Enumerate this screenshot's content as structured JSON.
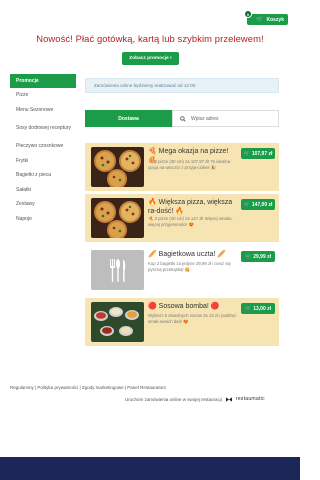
{
  "header": {
    "cart_label": "Koszyk",
    "cart_count": "0",
    "headline": "Nowość! Płać gotówką, kartą lub szybkim przelewem!",
    "promo_button": "Zobacz promocje !"
  },
  "sidebar": {
    "items": [
      {
        "label": "Promocje",
        "active": true
      },
      {
        "label": "Pizze"
      },
      {
        "label": "Menu Sezonowe"
      },
      {
        "label": "Sosy dodrowej receptury"
      },
      {
        "label": "Pieczywo czosnkowe"
      },
      {
        "label": "Frytki"
      },
      {
        "label": "Bagietki z pieca"
      },
      {
        "label": "Sałatki"
      },
      {
        "label": "Zestawy"
      },
      {
        "label": "Napoje"
      }
    ]
  },
  "main": {
    "notice": "Zamówienia online będziemy realizować od 12:00",
    "tab_delivery": "Dostawa",
    "address_placeholder": "Wpisz adres",
    "items": [
      {
        "title": "🍕 Mega okazja na pizze! 🍕",
        "desc": "🍕 3 pizze (30 cm) za 107,97 zł! To idealna opcja na wieczór z przyja-ciółmi! 🎉",
        "price": "107,97 zł"
      },
      {
        "title": "🔥 Większa pizza, większa ra-dość! 🔥",
        "desc": "🍕 3 pizze (40 cm) za 147 zł! Więcej smaku, więcej przyjemności! 😍",
        "price": "147,00 zł"
      },
      {
        "title": "🥖 Bagietkowa uczta! 🥖",
        "desc": "Kup 2 bagietki za jedyne 29,99 zł i ciesz się pyszną przekąską! 😋",
        "price": "29,99 zł"
      },
      {
        "title": "🔴 Sosowa bomba! 🔴",
        "desc": "Wybierz 5 dowolnych sosów za 13 zł i podkręć smak swoich dań! 😍",
        "price": "13,00 zł"
      }
    ]
  },
  "footer": {
    "links": "Regulaminy | Polityka prywatności | Zgody marketingowe | Panel Restaurators",
    "powered": "Uruchom zamówienia online w swojej restauracji",
    "logo": "restaumatic"
  },
  "colors": {
    "accent": "#1a9c48",
    "headline": "#b22222",
    "item_bg": "#f6e4b3",
    "bottom_band": "#1c2658"
  }
}
